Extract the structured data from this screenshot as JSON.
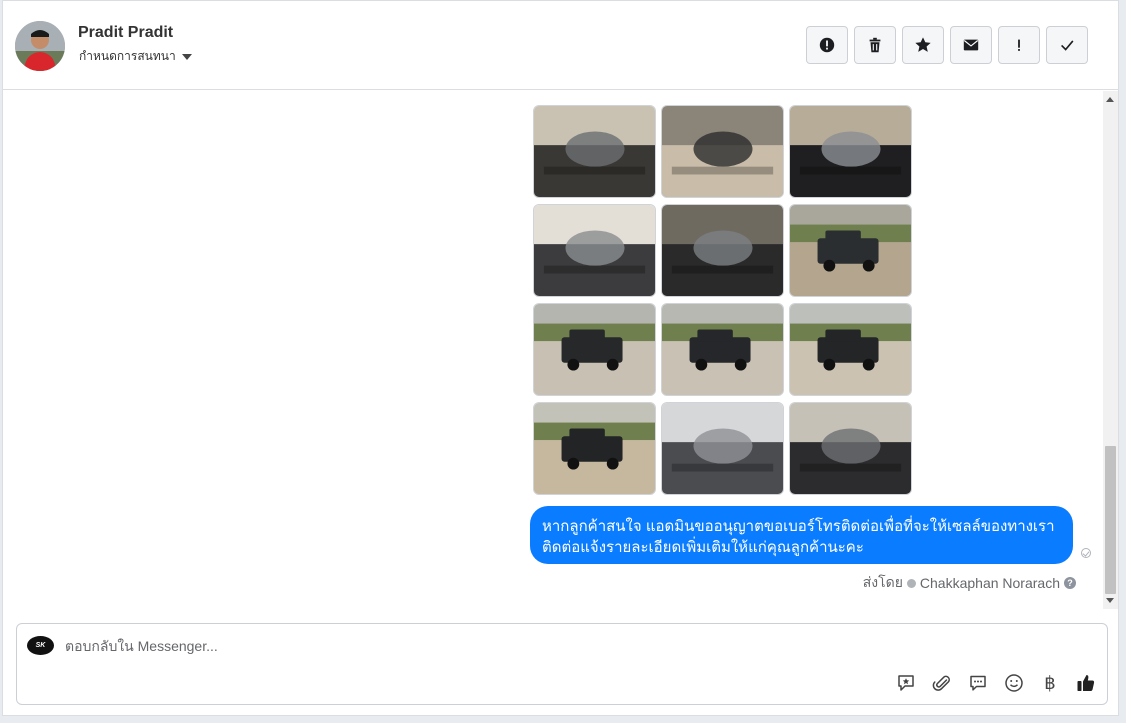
{
  "header": {
    "user_name": "Pradit Pradit",
    "assign_label": "กำหนดการสนทนา",
    "actions": [
      {
        "icon": "spam-icon",
        "label": "Mark as spam"
      },
      {
        "icon": "trash-icon",
        "label": "Delete"
      },
      {
        "icon": "star-icon",
        "label": "Star"
      },
      {
        "icon": "envelope-icon",
        "label": "Mark as unread"
      },
      {
        "icon": "exclamation-icon",
        "label": "Follow up"
      },
      {
        "icon": "check-icon",
        "label": "Mark as done"
      }
    ]
  },
  "gallery": {
    "photos": [
      {
        "subject": "steering-wheel-dashboard",
        "sky": "#c9c2b2",
        "ground": "#3a3835",
        "accent": "#6b6e72"
      },
      {
        "subject": "gear-shifter",
        "sky": "#8a8479",
        "ground": "#c9bda9",
        "accent": "#2d2d2d"
      },
      {
        "subject": "instrument-cluster",
        "sky": "#b7ac98",
        "ground": "#1f1f21",
        "accent": "#8b8f95"
      },
      {
        "subject": "door-panel",
        "sky": "#e4dfd6",
        "ground": "#3c3c3e",
        "accent": "#8a8d90"
      },
      {
        "subject": "engine-bay",
        "sky": "#6f6a60",
        "ground": "#2a2a2a",
        "accent": "#7c7f83"
      },
      {
        "subject": "truck-front",
        "sky": "#a9a79c",
        "ground": "#b3a58e",
        "accent": "#2b2e30"
      },
      {
        "subject": "truck-rear",
        "sky": "#b4b5ae",
        "ground": "#c8c0b2",
        "accent": "#26282a"
      },
      {
        "subject": "truck-rear-side",
        "sky": "#b7b8b1",
        "ground": "#c9c1b3",
        "accent": "#25272a"
      },
      {
        "subject": "truck-side",
        "sky": "#bdbfba",
        "ground": "#cbc2b2",
        "accent": "#232527"
      },
      {
        "subject": "truck-front-angle",
        "sky": "#c3c2b8",
        "ground": "#c6b89f",
        "accent": "#222426"
      },
      {
        "subject": "interior-seats",
        "sky": "#d6d7d8",
        "ground": "#4a4c50",
        "accent": "#8e9196"
      },
      {
        "subject": "interior-rear-view",
        "sky": "#c6c1b7",
        "ground": "#2c2c2e",
        "accent": "#6d6f72"
      }
    ]
  },
  "message": {
    "line1": "หากลูกค้าสนใจ แอดมินขออนุญาตขอเบอร์โทรติดต่อเพื่อที่จะให้เซลล์ของทางเรา",
    "line2": "ติดต่อแจ้งรายละเอียดเพิ่มเติมให้แก่คุณลูกค้านะคะ",
    "bubble_color": "#0a7cff"
  },
  "sender": {
    "prefix": "ส่งโดย",
    "name": "Chakkaphan Norarach",
    "help": "?"
  },
  "composer": {
    "page_logo_text": "SK",
    "placeholder": "ตอบกลับใน Messenger...",
    "tools": [
      "saved-reply-icon",
      "attachment-icon",
      "chat-bubble-icon",
      "emoji-icon",
      "baht-icon",
      "like-icon"
    ],
    "baht_symbol": "฿"
  }
}
